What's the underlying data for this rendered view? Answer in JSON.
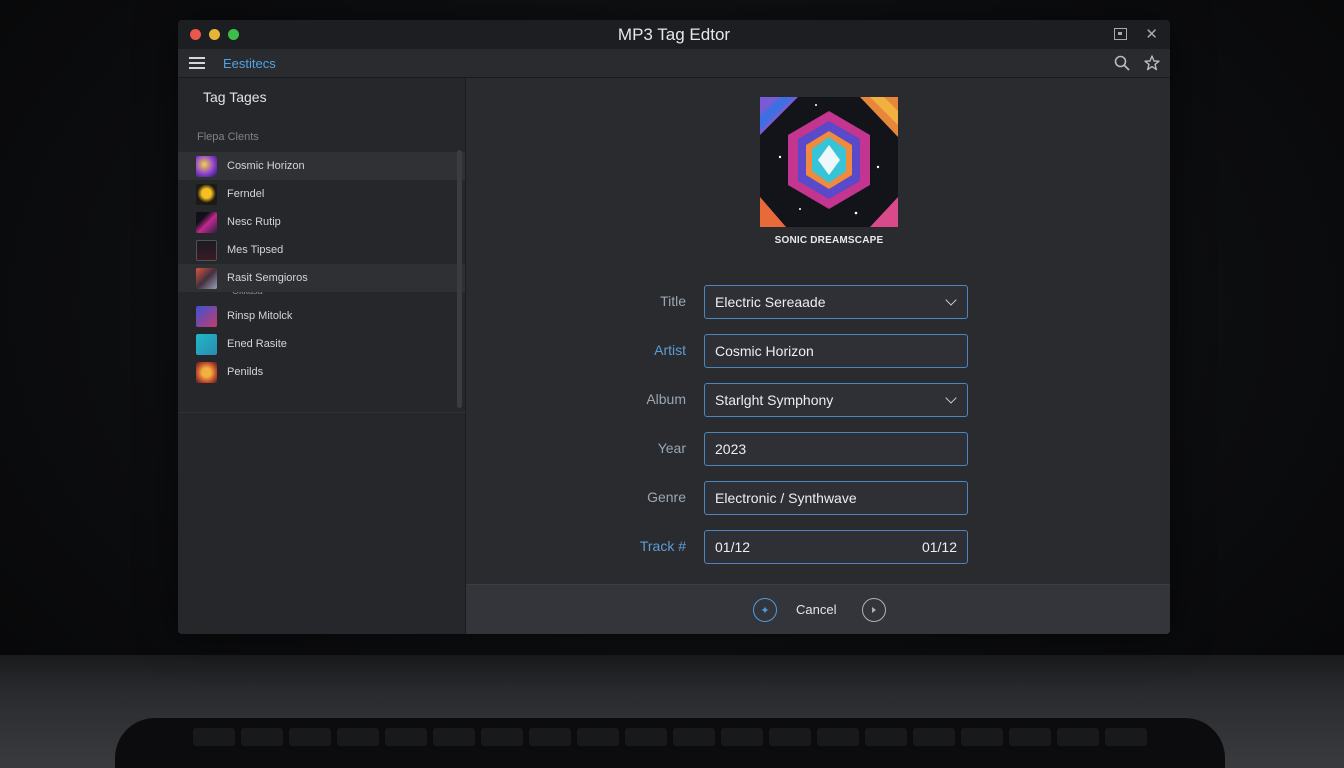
{
  "window": {
    "title": "MP3 Tag Edtor"
  },
  "toolbar": {
    "link_label": "Eestitecs",
    "icons": [
      "menu-icon",
      "search-icon",
      "star-icon"
    ]
  },
  "sidebar": {
    "title": "Tag Tages",
    "section_label": "Flepa Clents",
    "items": [
      {
        "label": "Cosmic Horizon",
        "thumb": "t1",
        "state": "active"
      },
      {
        "label": "Ferndel",
        "thumb": "t2",
        "state": ""
      },
      {
        "label": "Nesc Rutip",
        "thumb": "t3",
        "state": ""
      },
      {
        "label": "Mes Tipsed",
        "thumb": "t4",
        "state": ""
      },
      {
        "label": "Rasit Semgioros",
        "thumb": "t5",
        "state": "hl"
      },
      {
        "label": "Rinsp Mitolck",
        "thumb": "t6",
        "state": ""
      },
      {
        "label": "Ened Rasite",
        "thumb": "t7",
        "state": ""
      },
      {
        "label": "Penilds",
        "thumb": "t8",
        "state": ""
      }
    ],
    "ghost_line": "Okkasa"
  },
  "cover": {
    "caption": "SONIC DREAMSCAPE"
  },
  "form": {
    "fields": [
      {
        "label": "Title",
        "value": "Electric Sereaade",
        "dropdown": true
      },
      {
        "label": "Artist",
        "value": "Cosmic Horizon",
        "dropdown": false
      },
      {
        "label": "Album",
        "value": "Starlght Symphony",
        "dropdown": true
      },
      {
        "label": "Year",
        "value": "2023",
        "dropdown": false
      },
      {
        "label": "Genre",
        "value": "Electronic / Synthwave",
        "dropdown": false
      },
      {
        "label": "Track #",
        "value": "01/12",
        "right_value": "01/12",
        "dropdown": false
      }
    ]
  },
  "actions": {
    "cancel_label": "Cancel",
    "add_icon": "add-icon",
    "next_icon": "next-icon"
  },
  "colors": {
    "accent": "#4a9de4",
    "window_bg": "#232428",
    "field_border": "#4b86bf"
  }
}
